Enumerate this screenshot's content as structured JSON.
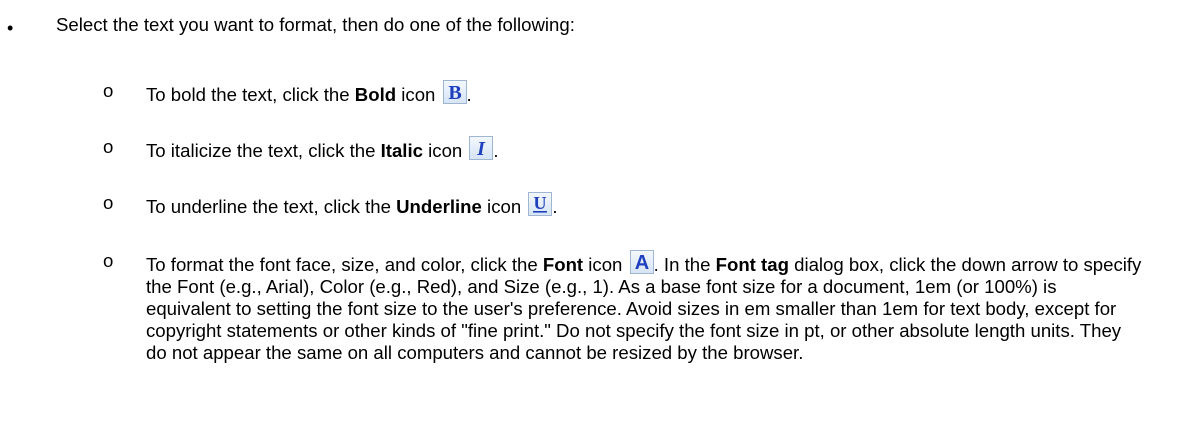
{
  "intro": "Select the text you want to format, then do one of the following:",
  "items": [
    {
      "before": "To bold the text, click the ",
      "bold": "Bold",
      "after": " icon",
      "end": ".",
      "icon_letter": "B",
      "icon_name": "bold-icon"
    },
    {
      "before": "To italicize the text, click the ",
      "bold": "Italic",
      "after": " icon",
      "end": ".",
      "icon_letter": "I",
      "icon_name": "italic-icon"
    },
    {
      "before": "To underline the text, click the ",
      "bold": "Underline",
      "after": " icon",
      "end": ".",
      "icon_letter": "U",
      "icon_name": "underline-icon"
    },
    {
      "before": "To format the font face, size, and color, click the ",
      "bold": "Font",
      "after": " icon",
      "end": ". In the ",
      "bold2": "Font tag",
      "rest": " dialog box, click the down arrow to specify the Font (e.g., Arial), Color (e.g., Red), and Size (e.g., 1). As a base font size for a document, 1em (or 100%) is equivalent to setting the font size to the user's preference. Avoid sizes in em smaller than 1em for text body, except for copyright statements or other kinds of \"fine print.\" Do not specify the font size in pt, or other absolute length units. They do not appear the same on all computers and cannot be resized by the browser.",
      "icon_letter": "A",
      "icon_name": "font-icon"
    }
  ],
  "markers": {
    "bullet": "•",
    "sub": "o"
  },
  "colors": {
    "icon_letter": "#1f3fbf",
    "icon_bg_top": "#f4f8fd",
    "icon_bg_bottom": "#d6e4f5",
    "icon_border": "#9fb6d3"
  }
}
